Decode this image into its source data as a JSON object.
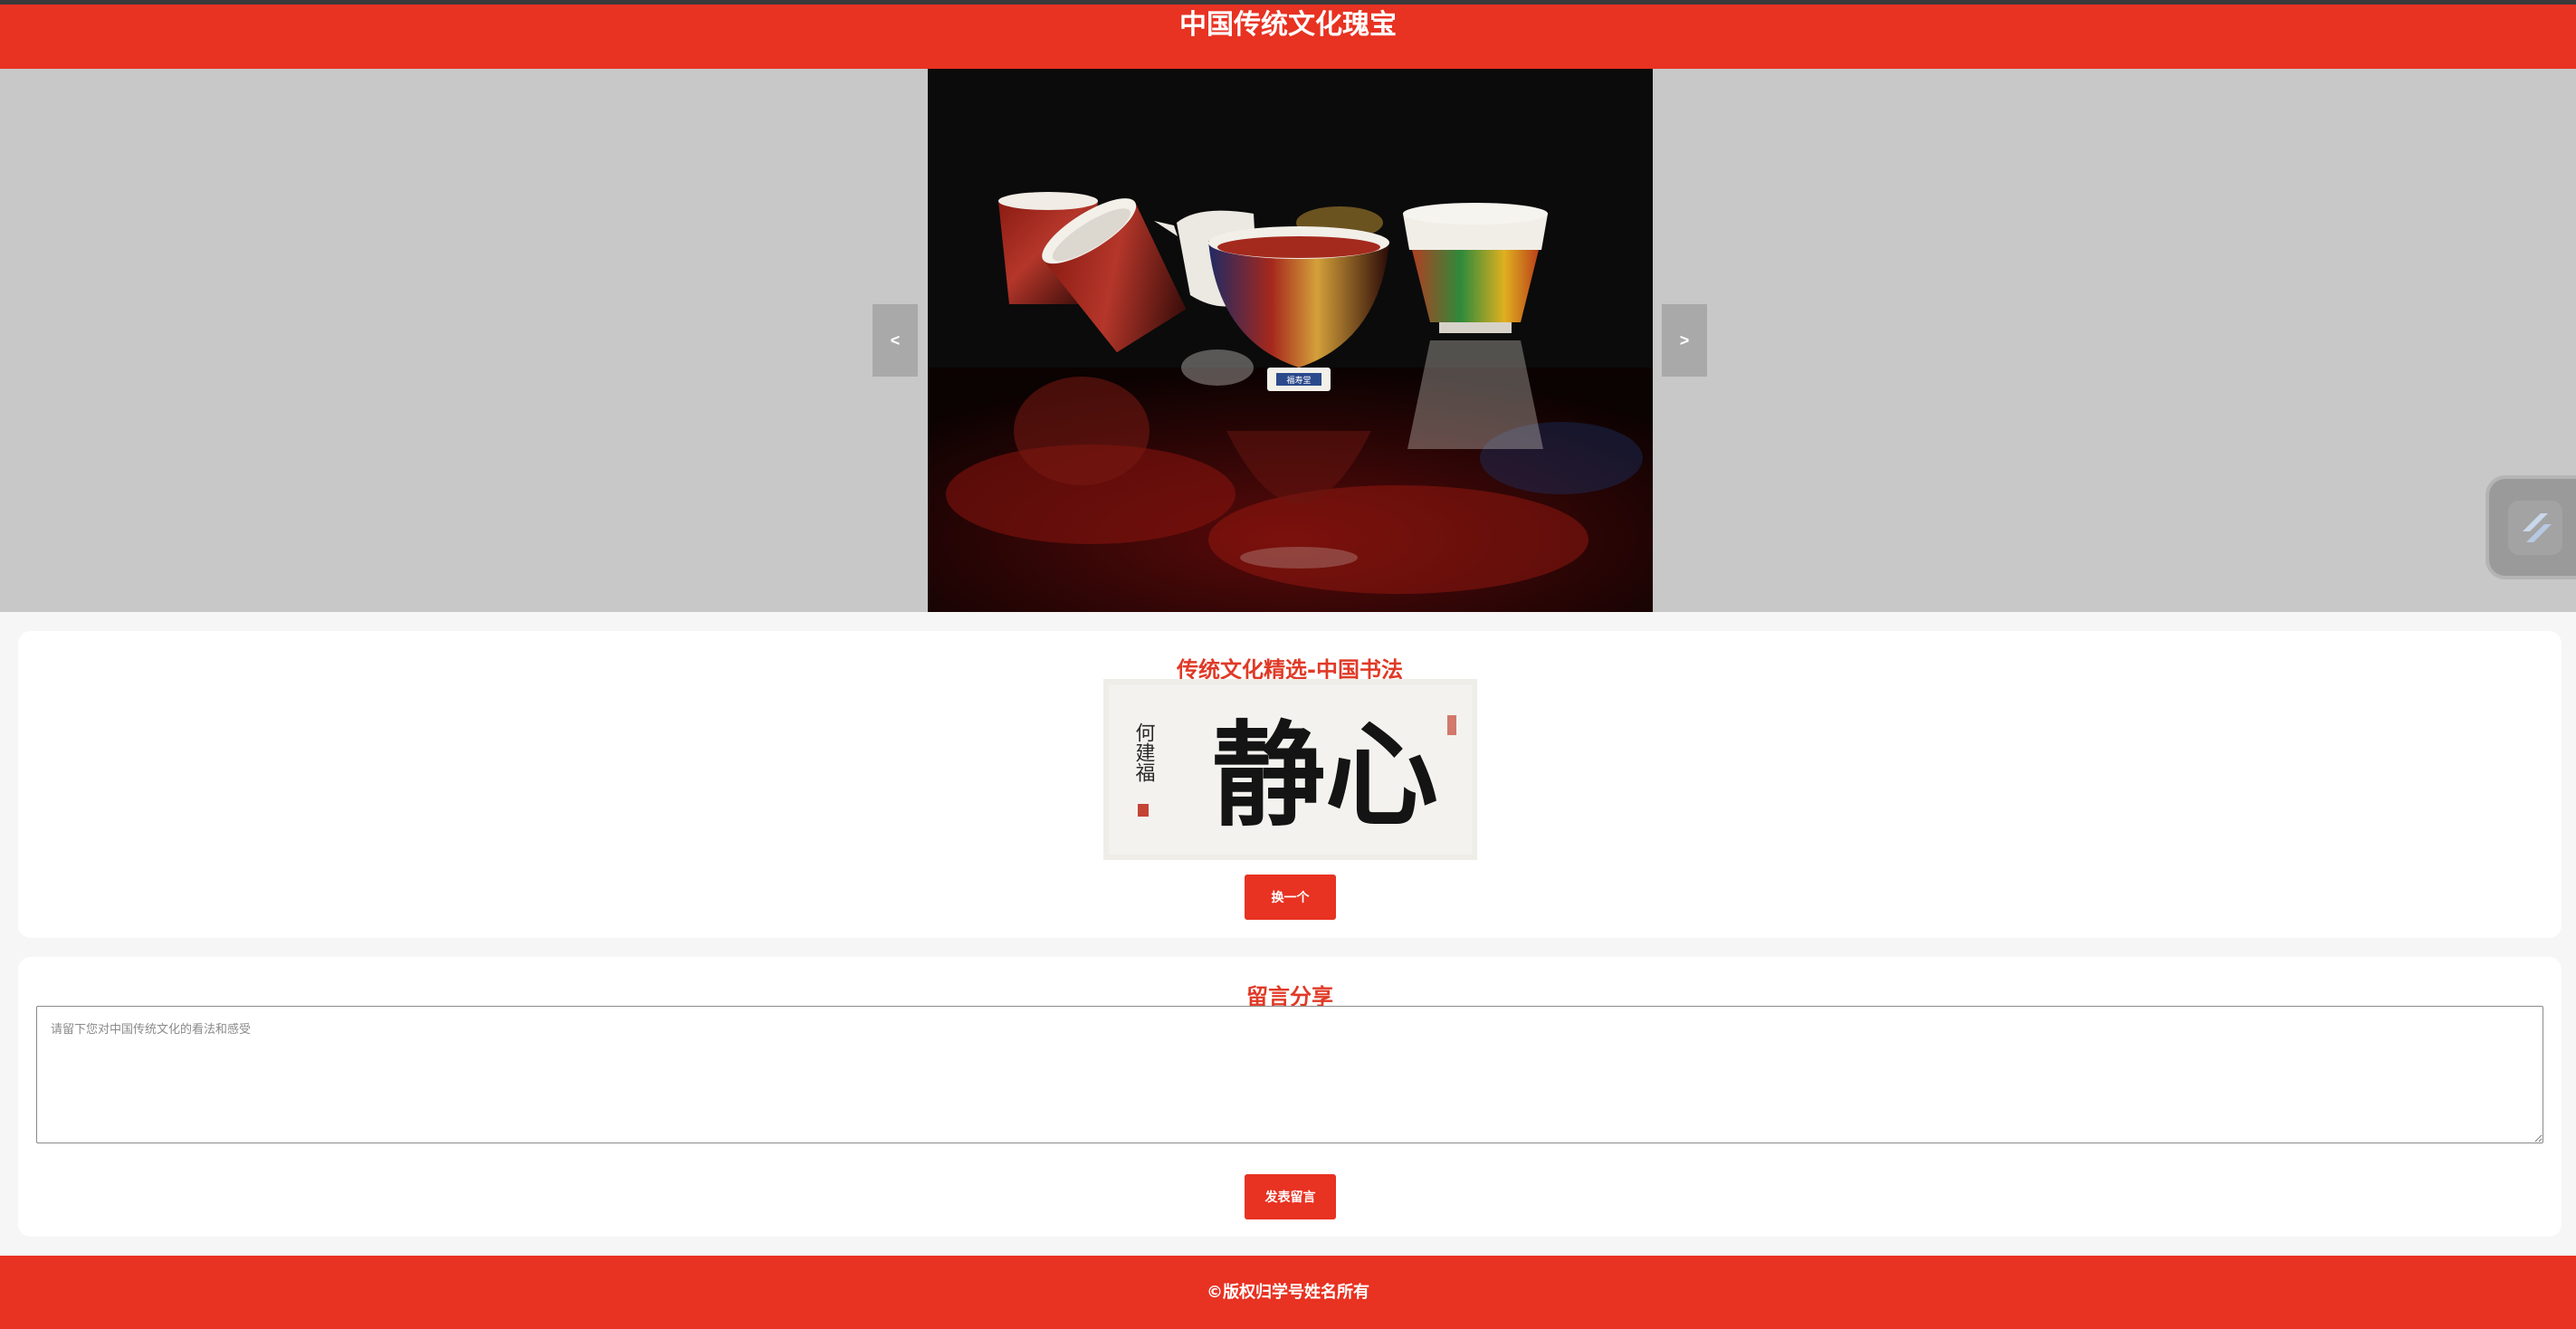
{
  "header": {
    "title": "中国传统文化瑰宝"
  },
  "carousel": {
    "prev_label": "<",
    "next_label": ">",
    "current_slide": "porcelain-tea-cups",
    "seal_text": "福寿堂"
  },
  "calligraphy": {
    "title": "传统文化精选-中国书法",
    "artwork_text": "静心",
    "signature": "何建福",
    "change_button": "换一个"
  },
  "comment": {
    "title": "留言分享",
    "placeholder": "请留下您对中国传统文化的看法和感受",
    "value": "",
    "submit_button": "发表留言"
  },
  "footer": {
    "text": "©版权归学号姓名所有"
  },
  "floating_widget": {
    "icon": "slash-app-icon"
  },
  "colors": {
    "brand_red": "#e83222",
    "title_red": "#e03a27",
    "carousel_bg": "#c8c8c8",
    "nav_button_bg": "#a9a9a9"
  }
}
